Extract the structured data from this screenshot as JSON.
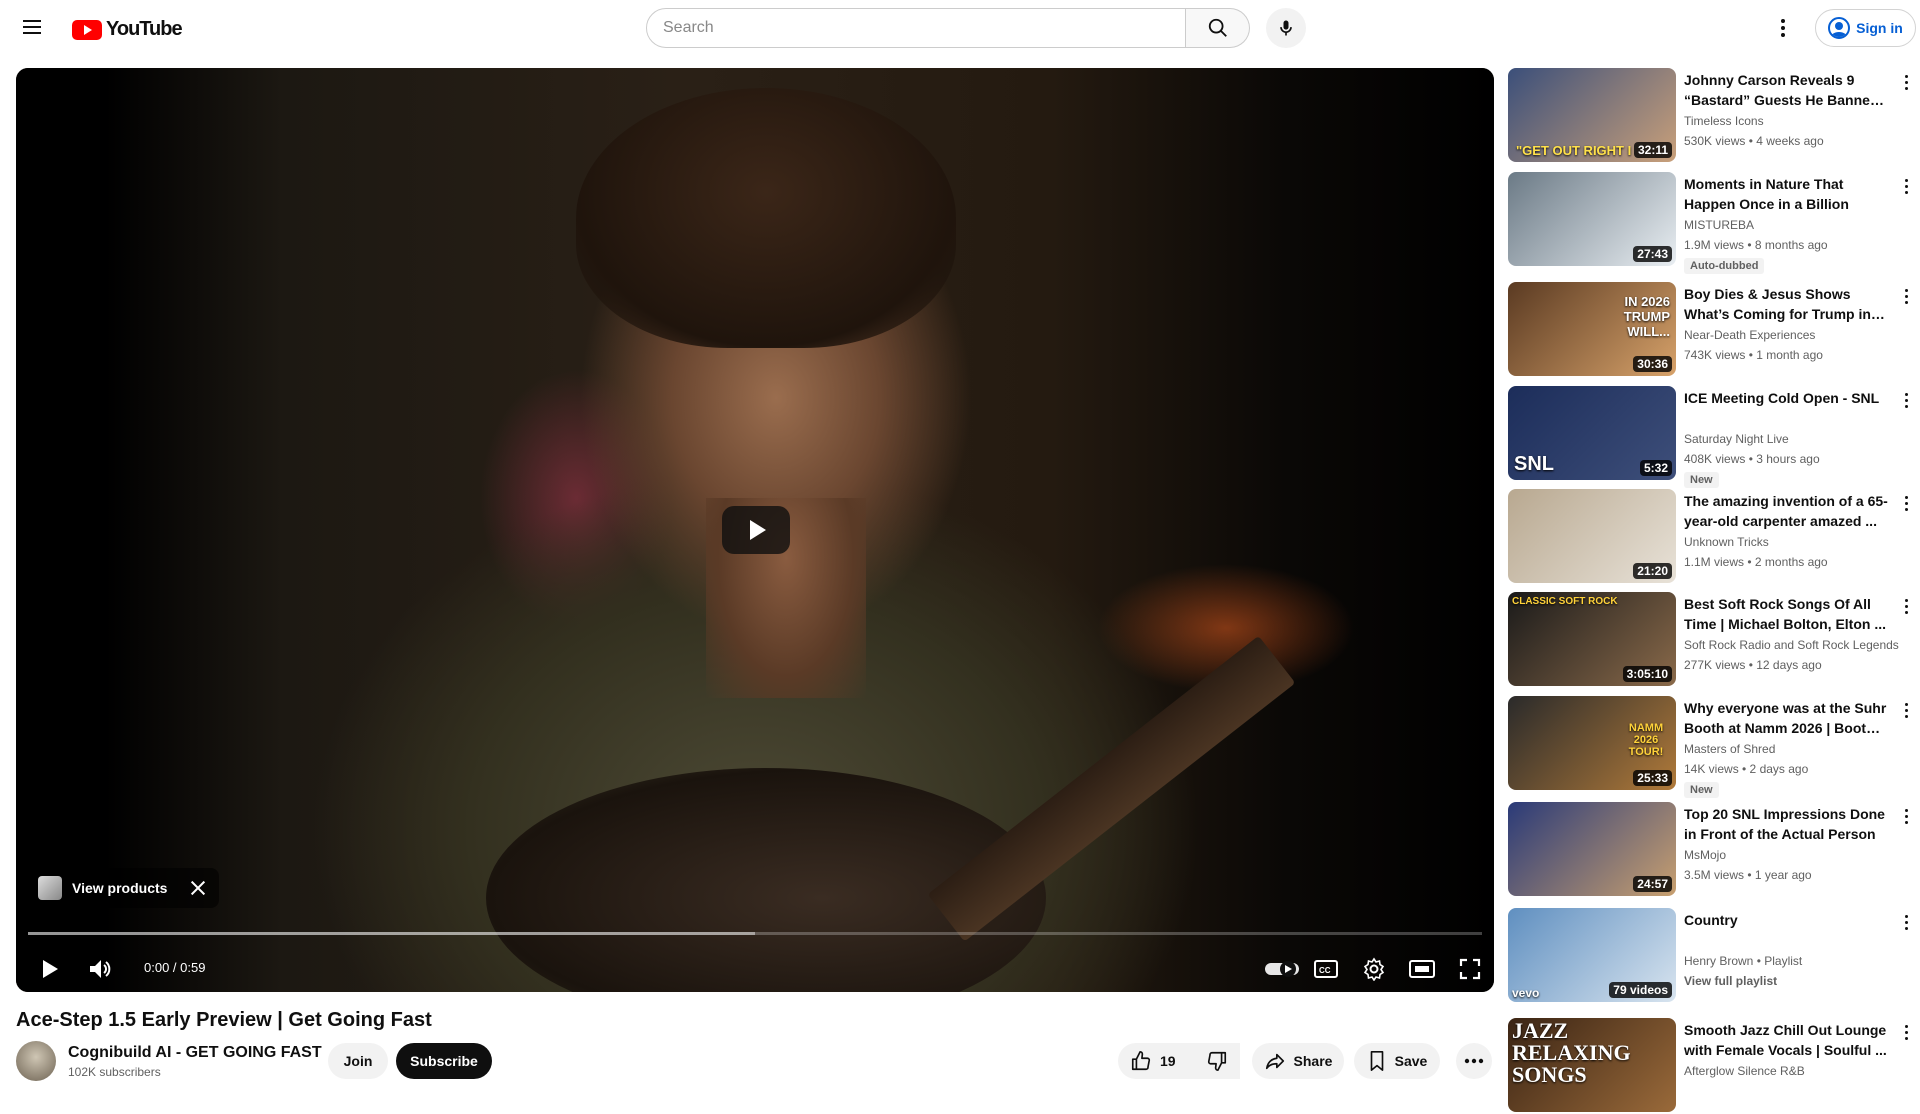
{
  "header": {
    "logo_text": "YouTube",
    "search_placeholder": "Search",
    "signin_label": "Sign in"
  },
  "player": {
    "view_products_label": "View products",
    "time_current": "0:00",
    "time_separator": " / ",
    "time_total": "0:59",
    "progress_loaded_fraction": 0.5
  },
  "video": {
    "title": "Ace-Step 1.5 Early Preview | Get Going Fast",
    "channel_name": "Cognibuild AI - GET GOING FAST",
    "subscribers": "102K subscribers",
    "join_label": "Join",
    "subscribe_label": "Subscribe",
    "like_count": "19",
    "share_label": "Share",
    "save_label": "Save"
  },
  "recommendations": [
    {
      "title": "Johnny Carson Reveals 9 “Bastard” Guests He Banned f...",
      "channel": "Timeless Icons",
      "meta": "530K views • 4 weeks ago",
      "duration": "32:11",
      "thumb_text": "\"GET OUT RIGHT I",
      "badge": "",
      "colors": [
        "#3b4f7a",
        "#c9a07a"
      ]
    },
    {
      "title": "Moments in Nature That Happen Once in a Billion",
      "channel": "MISTUREBA",
      "meta": "1.9M views • 8 months ago",
      "duration": "27:43",
      "thumb_text": "",
      "badge": "Auto-dubbed",
      "colors": [
        "#6b7a86",
        "#e9eef2"
      ]
    },
    {
      "title": "Boy Dies & Jesus Shows What’s Coming for Trump in 2026! | ...",
      "channel": "Near-Death Experiences",
      "meta": "743K views • 1 month ago",
      "duration": "30:36",
      "thumb_text": "IN 2026 TRUMP WILL...",
      "badge": "",
      "colors": [
        "#5a3a22",
        "#d7a26a"
      ]
    },
    {
      "title": "ICE Meeting Cold Open - SNL",
      "channel": "Saturday Night Live",
      "meta": "408K views • 3 hours ago",
      "duration": "5:32",
      "thumb_text": "SNL",
      "badge": "New",
      "colors": [
        "#1c2d5a",
        "#3e4f7a"
      ]
    },
    {
      "title": "The amazing invention of a 65-year-old carpenter amazed ...",
      "channel": "Unknown Tricks",
      "meta": "1.1M views • 2 months ago",
      "duration": "21:20",
      "thumb_text": "",
      "badge": "",
      "colors": [
        "#b8a890",
        "#e8e2d8"
      ]
    },
    {
      "title": "Best Soft Rock Songs Of All Time | Michael Bolton, Elton ...",
      "channel": "Soft Rock Radio and Soft Rock Legends",
      "meta": "277K views • 12 days ago",
      "duration": "3:05:10",
      "thumb_text": "CLASSIC SOFT ROCK",
      "badge": "",
      "colors": [
        "#1a1a1a",
        "#8a6a4a"
      ]
    },
    {
      "title": "Why everyone was at the Suhr Booth at Namm 2026 | Booth ...",
      "channel": "Masters of Shred",
      "meta": "14K views • 2 days ago",
      "duration": "25:33",
      "thumb_text": "NAMM 2026 TOUR!",
      "badge": "New",
      "colors": [
        "#2a2a2a",
        "#b07a3a"
      ]
    },
    {
      "title": "Top 20 SNL Impressions Done in Front of the Actual Person",
      "channel": "MsMojo",
      "meta": "3.5M views • 1 year ago",
      "duration": "24:57",
      "thumb_text": "",
      "badge": "",
      "colors": [
        "#2a3a78",
        "#c8a070"
      ]
    },
    {
      "title": "Country",
      "channel": "Henry Brown • Playlist",
      "meta": "View full playlist",
      "duration": "79 videos",
      "thumb_text": "vevo",
      "badge": "",
      "colors": [
        "#5f8fc0",
        "#d8e4ef"
      ]
    },
    {
      "title": "Smooth Jazz Chill Out Lounge with Female Vocals | Soulful ...",
      "channel": "Afterglow Silence R&B",
      "meta": "",
      "duration": "",
      "thumb_text": "JAZZ RELAXING SONGS",
      "badge": "",
      "colors": [
        "#3a2414",
        "#9a6a3a"
      ]
    }
  ]
}
